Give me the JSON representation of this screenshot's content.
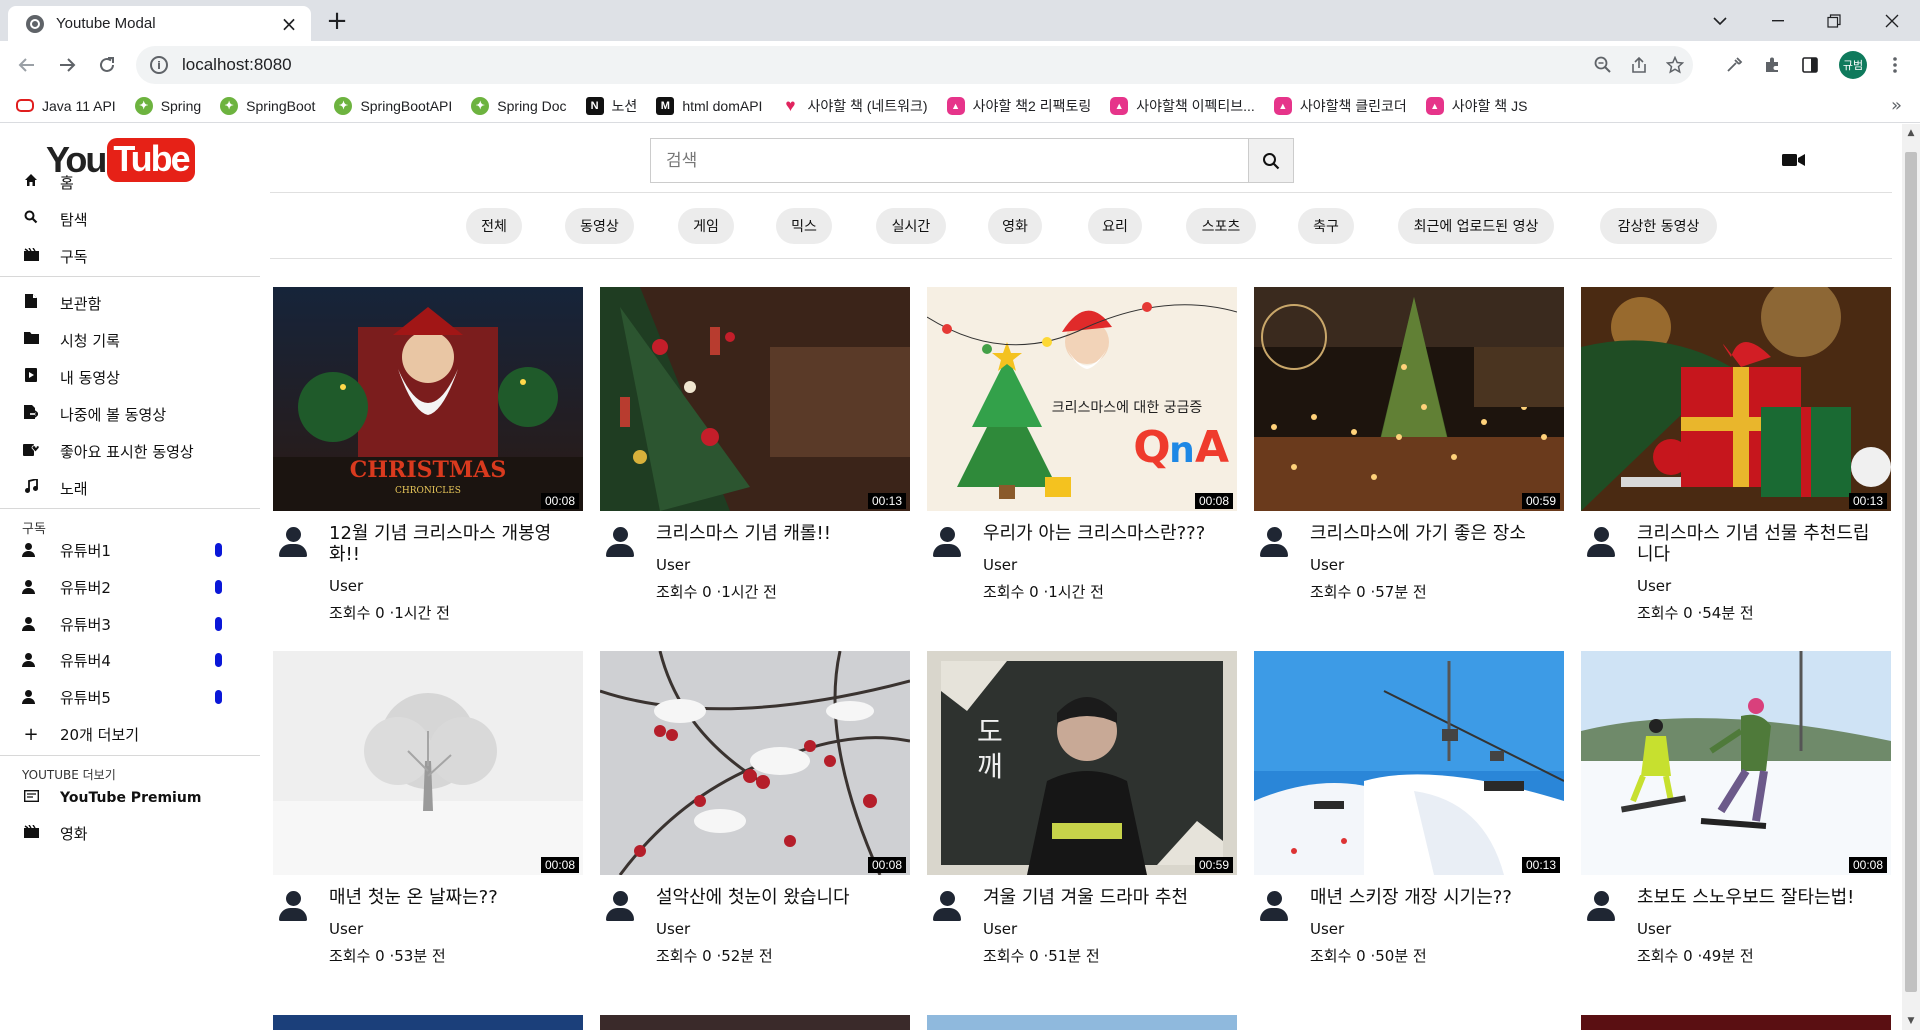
{
  "browser": {
    "tab_title": "Youtube Modal",
    "url": "localhost:8080",
    "profile_label": "규범",
    "bookmarks": [
      {
        "label": "Java 11 API",
        "icon": "oracle-icon",
        "color": "#e01e1e"
      },
      {
        "label": "Spring",
        "icon": "spring-icon",
        "color": "#6db33f"
      },
      {
        "label": "SpringBoot",
        "icon": "spring-icon",
        "color": "#6db33f"
      },
      {
        "label": "SpringBootAPI",
        "icon": "spring-icon",
        "color": "#6db33f"
      },
      {
        "label": "Spring Doc",
        "icon": "spring-icon",
        "color": "#6db33f"
      },
      {
        "label": "노션",
        "icon": "notion-icon",
        "color": "#111111"
      },
      {
        "label": "html domAPI",
        "icon": "mdn-icon",
        "color": "#111111"
      },
      {
        "label": "사야할 책 (네트워크)",
        "icon": "heart-icon",
        "color": "#e0245e"
      },
      {
        "label": "사야할 책2 리팩토링",
        "icon": "book-store-icon",
        "color": "#e6348a"
      },
      {
        "label": "사야할책 이펙티브...",
        "icon": "book-store-icon",
        "color": "#e6348a"
      },
      {
        "label": "사야할책 클린코더",
        "icon": "book-store-icon",
        "color": "#e6348a"
      },
      {
        "label": "사야할 책 JS",
        "icon": "book-store-icon",
        "color": "#e6348a"
      }
    ]
  },
  "logo": {
    "you": "You",
    "tube": "Tube"
  },
  "search": {
    "placeholder": "검색"
  },
  "sidebar": {
    "main": [
      {
        "label": "홈",
        "icon": "home-icon"
      },
      {
        "label": "탐색",
        "icon": "search-icon"
      },
      {
        "label": "구독",
        "icon": "subscriptions-icon"
      }
    ],
    "library": [
      {
        "label": "보관함",
        "icon": "library-icon"
      },
      {
        "label": "시청 기록",
        "icon": "folder-icon"
      },
      {
        "label": "내 동영상",
        "icon": "my-videos-icon"
      },
      {
        "label": "나중에 볼 동영상",
        "icon": "watch-later-icon"
      },
      {
        "label": "좋아요 표시한 동영상",
        "icon": "liked-icon"
      },
      {
        "label": "노래",
        "icon": "music-icon"
      }
    ],
    "subscriptions_heading": "구독",
    "subscriptions": [
      {
        "label": "유튜버1"
      },
      {
        "label": "유튜버2"
      },
      {
        "label": "유튜버3"
      },
      {
        "label": "유튜버4"
      },
      {
        "label": "유튜버5"
      }
    ],
    "more_label": "20개 더보기",
    "more_heading": "YOUTUBE 더보기",
    "extra": [
      {
        "label": "YouTube Premium",
        "icon": "premium-icon"
      },
      {
        "label": "영화",
        "icon": "movie-icon"
      }
    ]
  },
  "chips": [
    "전체",
    "동영상",
    "게임",
    "믹스",
    "실시간",
    "영화",
    "요리",
    "스포츠",
    "축구",
    "최근에 업로드된 영상",
    "감상한 동영상"
  ],
  "videos": [
    {
      "title": "12월 기념 크리스마스 개봉영화!!",
      "channel": "User",
      "meta": "조회수 0 ·1시간 전",
      "duration": "00:08",
      "thumb": "poster"
    },
    {
      "title": "크리스마스 기념 캐롤!!",
      "channel": "User",
      "meta": "조회수 0 ·1시간 전",
      "duration": "00:13",
      "thumb": "tree"
    },
    {
      "title": "우리가 아는 크리스마스란???",
      "channel": "User",
      "meta": "조회수 0 ·1시간 전",
      "duration": "00:08",
      "thumb": "qna"
    },
    {
      "title": "크리스마스에 가기 좋은 장소",
      "channel": "User",
      "meta": "조회수 0 ·57분 전",
      "duration": "00:59",
      "thumb": "market"
    },
    {
      "title": "크리스마스 기념 선물 추천드립니다",
      "channel": "User",
      "meta": "조회수 0 ·54분 전",
      "duration": "00:13",
      "thumb": "gifts"
    },
    {
      "title": "매년 첫눈 온 날짜는??",
      "channel": "User",
      "meta": "조회수 0 ·53분 전",
      "duration": "00:08",
      "thumb": "snowtree"
    },
    {
      "title": "설악산에 첫눈이 왔습니다",
      "channel": "User",
      "meta": "조회수 0 ·52분 전",
      "duration": "00:08",
      "thumb": "berries"
    },
    {
      "title": "겨울 기념 겨울 드라마 추천",
      "channel": "User",
      "meta": "조회수 0 ·51분 전",
      "duration": "00:59",
      "thumb": "drama"
    },
    {
      "title": "매년 스키장 개장 시기는??",
      "channel": "User",
      "meta": "조회수 0 ·50분 전",
      "duration": "00:13",
      "thumb": "ski"
    },
    {
      "title": "초보도 스노우보드 잘타는법!",
      "channel": "User",
      "meta": "조회수 0 ·49분 전",
      "duration": "00:08",
      "thumb": "snowboard"
    }
  ]
}
